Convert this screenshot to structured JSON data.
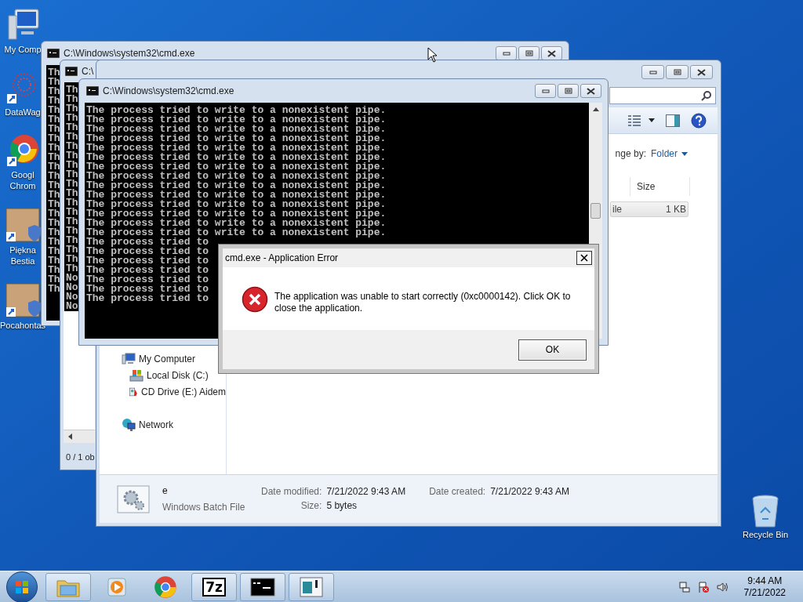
{
  "desktop_icons": [
    {
      "kind": "computer",
      "lines": [
        "My Comp"
      ]
    },
    {
      "kind": "network-art",
      "lines": [
        "DataWag"
      ]
    },
    {
      "kind": "browser",
      "lines": [
        "Googl",
        "Chrom"
      ]
    },
    {
      "kind": "picture",
      "lines": [
        "Piękna",
        "Bestia"
      ]
    },
    {
      "kind": "picture",
      "lines": [
        "Pocahontas"
      ]
    }
  ],
  "recycle_bin": {
    "label": "Recycle Bin"
  },
  "console_back": {
    "title": "C:\\Windows\\system32\\cmd.exe",
    "lines": [
      "Th",
      "Th",
      "Th",
      "Th",
      "Th",
      "Th",
      "Th",
      "Th",
      "Th",
      "Th",
      "Th",
      "Th",
      "Th",
      "Th",
      "Th",
      "Th",
      "Th",
      "Th",
      "Th",
      "Th",
      "Th",
      "Th",
      "Th",
      "Th"
    ]
  },
  "console_middle": {
    "title": "C:\\",
    "lines": [
      "Th",
      "Th",
      "Th",
      "Th",
      "Th",
      "Th",
      "Th",
      "Th",
      "Th",
      "Th",
      "Th",
      "Th",
      "Th",
      "Th",
      "Th",
      "Th",
      "Th",
      "Th",
      "Th",
      "Th",
      "No",
      "No",
      "No",
      "No"
    ],
    "status": "0 / 1 ob"
  },
  "explorer": {
    "arrange_label": "nge by:",
    "arrange_value": "Folder",
    "columns": [
      "Size"
    ],
    "rows": [
      {
        "name": "ile",
        "size": "1 KB"
      }
    ],
    "nav": [
      {
        "kind": "computer",
        "label": "My Computer",
        "children": [
          {
            "kind": "disk",
            "label": "Local Disk (C:)"
          },
          {
            "kind": "cd",
            "label": "CD Drive (E:) Aidem"
          }
        ]
      },
      {
        "kind": "network",
        "label": "Network"
      }
    ],
    "details": {
      "name": "e",
      "type": "Windows Batch File",
      "fields": [
        {
          "label": "Date modified:",
          "value": "7/21/2022 9:43 AM"
        },
        {
          "label": "Size:",
          "value": "5 bytes"
        },
        {
          "label": "Date created:",
          "value": "7/21/2022 9:43 AM"
        }
      ]
    }
  },
  "console_front": {
    "title": "C:\\Windows\\system32\\cmd.exe",
    "lines": [
      "The process tried to write to a nonexistent pipe.",
      "The process tried to write to a nonexistent pipe.",
      "The process tried to write to a nonexistent pipe.",
      "The process tried to write to a nonexistent pipe.",
      "The process tried to write to a nonexistent pipe.",
      "The process tried to write to a nonexistent pipe.",
      "The process tried to write to a nonexistent pipe.",
      "The process tried to write to a nonexistent pipe.",
      "The process tried to write to a nonexistent pipe.",
      "The process tried to write to a nonexistent pipe.",
      "The process tried to write to a nonexistent pipe.",
      "The process tried to write to a nonexistent pipe.",
      "The process tried to write to a nonexistent pipe.",
      "The process tried to write to a nonexistent pipe.",
      "The process tried to",
      "The process tried to",
      "The process tried to",
      "The process tried to",
      "The process tried to",
      "The process tried to",
      "The process tried to"
    ]
  },
  "error_dialog": {
    "title": "cmd.exe - Application Error",
    "message": "The application was unable to start correctly (0xc0000142). Click OK to close the application.",
    "buttons": [
      "OK"
    ]
  },
  "taskbar": {
    "items": [
      {
        "kind": "folder",
        "running": true
      },
      {
        "kind": "media",
        "running": false
      },
      {
        "kind": "browser",
        "running": false
      },
      {
        "kind": "archive",
        "label": "7z",
        "running": true
      },
      {
        "kind": "console",
        "running": true
      },
      {
        "kind": "app",
        "running": true
      }
    ]
  },
  "clock": {
    "time": "9:44 AM",
    "date": "7/21/2022"
  }
}
